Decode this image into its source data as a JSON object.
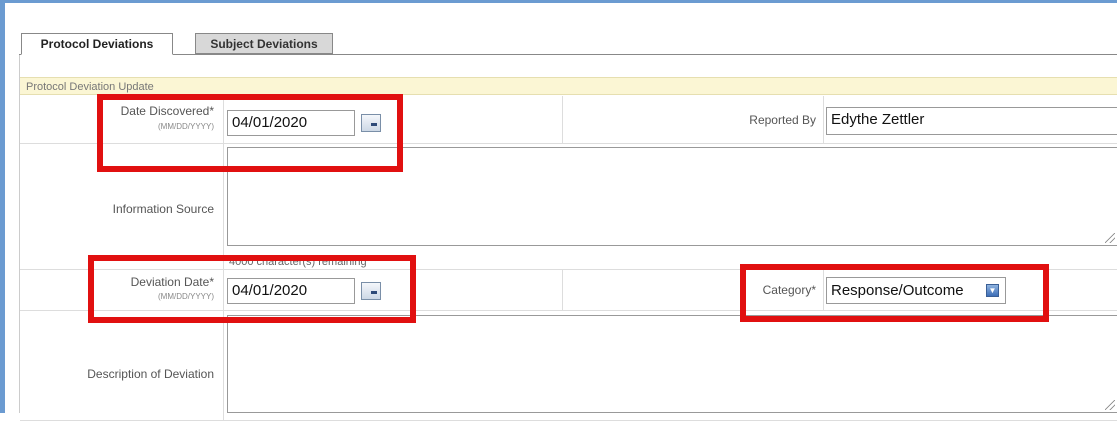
{
  "tabs": [
    {
      "label": "Protocol Deviations",
      "active": true
    },
    {
      "label": "Subject Deviations",
      "active": false
    }
  ],
  "section_header": "Protocol Deviation Update",
  "fields": {
    "date_discovered": {
      "label": "Date Discovered*",
      "format": "(MM/DD/YYYY)",
      "value": "04/01/2020"
    },
    "reported_by": {
      "label": "Reported By",
      "value": "Edythe Zettler"
    },
    "information_source": {
      "label": "Information Source",
      "value": ""
    },
    "chars_remaining": "4000 character(s) remaining",
    "deviation_date": {
      "label": "Deviation Date*",
      "format": "(MM/DD/YYYY)",
      "value": "04/01/2020"
    },
    "category": {
      "label": "Category*",
      "value": "Response/Outcome"
    },
    "description": {
      "label": "Description of Deviation",
      "value": ""
    }
  },
  "colors": {
    "highlight": "#e11010",
    "frame": "#6b9bd1",
    "section_header_bg": "#fbf6d4"
  },
  "icons": [
    "calendar-icon",
    "dropdown-arrow-icon",
    "resize-grip-icon"
  ]
}
